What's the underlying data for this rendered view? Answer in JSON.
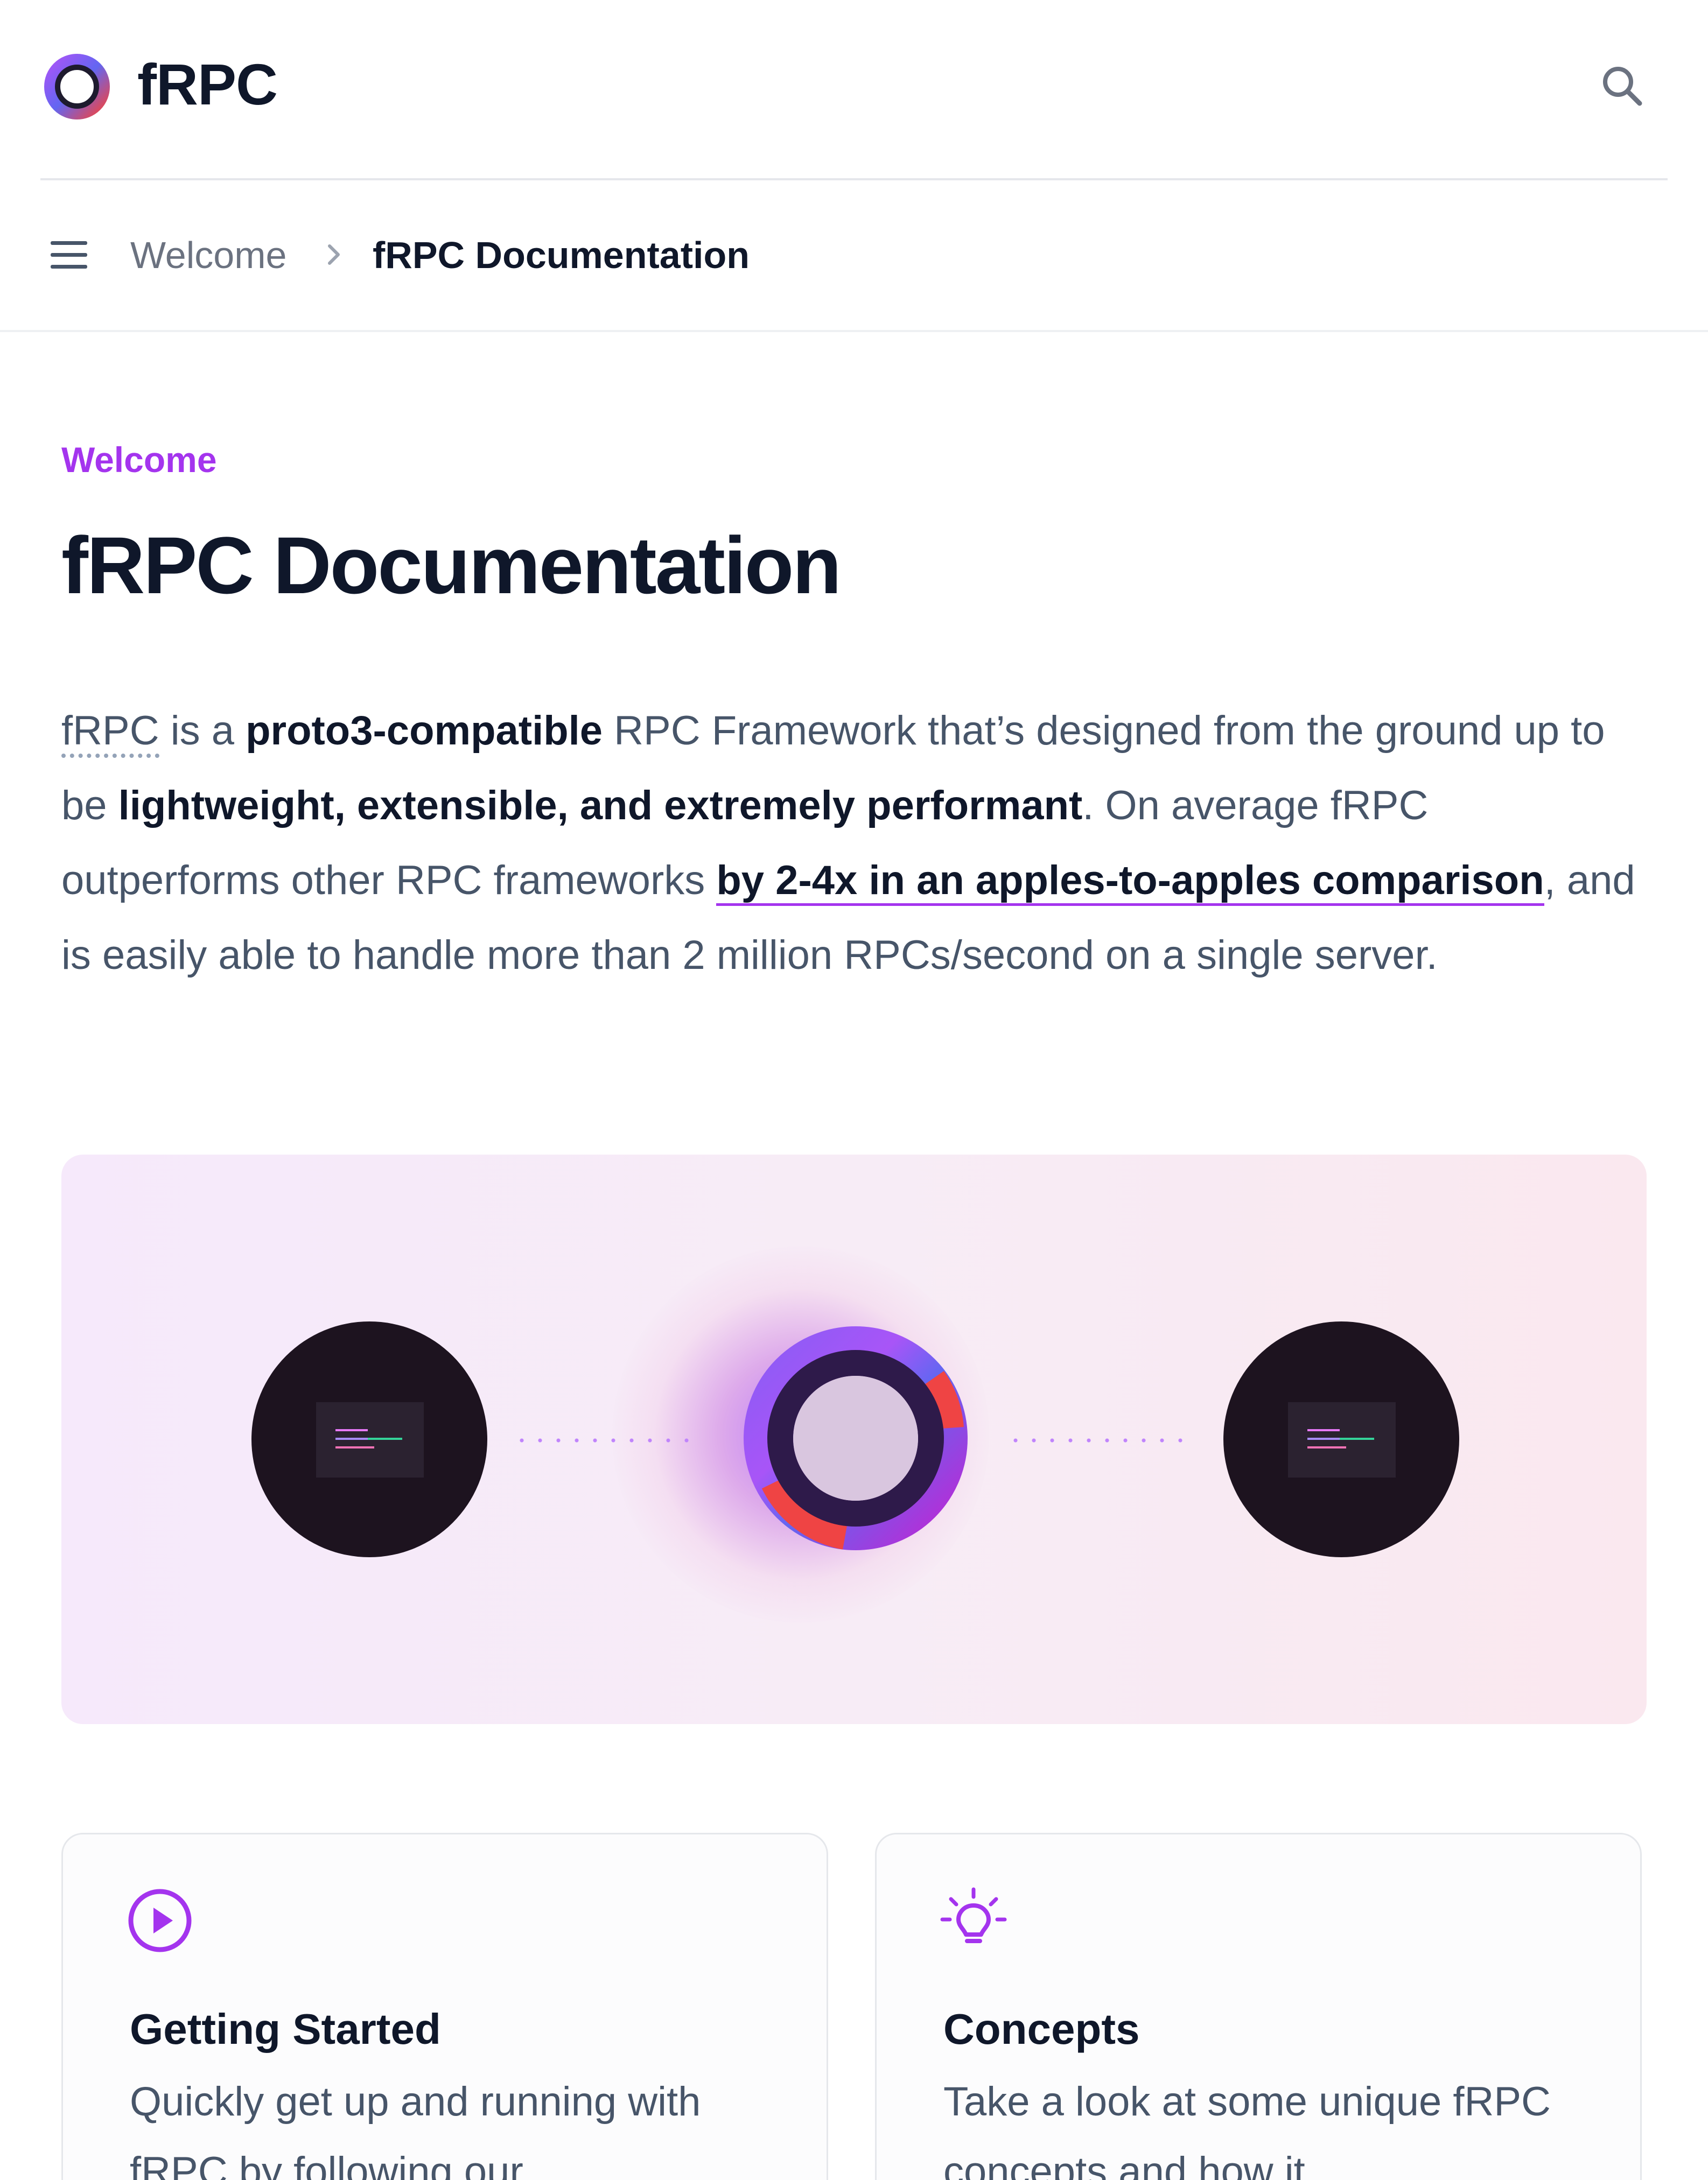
{
  "header": {
    "brand": "fRPC",
    "search_icon": "search-icon",
    "logo_icon": "frpc-ring-logo"
  },
  "breadcrumb": {
    "menu_icon": "hamburger-menu-icon",
    "items": [
      "Welcome",
      "fRPC Documentation"
    ],
    "separator_icon": "chevron-right-icon"
  },
  "main": {
    "eyebrow": "Welcome",
    "title": "fRPC Documentation",
    "intro": {
      "p1_abbr": "fRPC",
      "p2": " is a ",
      "p3_bold": "proto3-compatible",
      "p4": " RPC Framework that’s designed from the ground up to be ",
      "p5_bold": "lightweight, extensible, and extremely performant",
      "p6": ". On average fRPC outperforms other RPC frameworks ",
      "p7_link": "by 2-4x in an apples-to-apples comparison",
      "p8": ", and is easily able to handle more than 2 million RPCs/second on a single server."
    }
  },
  "cards": [
    {
      "icon": "play-circle-icon",
      "title": "Getting Started",
      "description": "Quickly get up and running with fRPC by following our"
    },
    {
      "icon": "lightbulb-icon",
      "title": "Concepts",
      "description": "Take a look at some unique fRPC concepts and how it"
    }
  ],
  "colors": {
    "accent": "#a434ee",
    "heading": "#0f172a",
    "body_text": "#475569",
    "muted": "#6b7280",
    "node": "#1d131f"
  }
}
